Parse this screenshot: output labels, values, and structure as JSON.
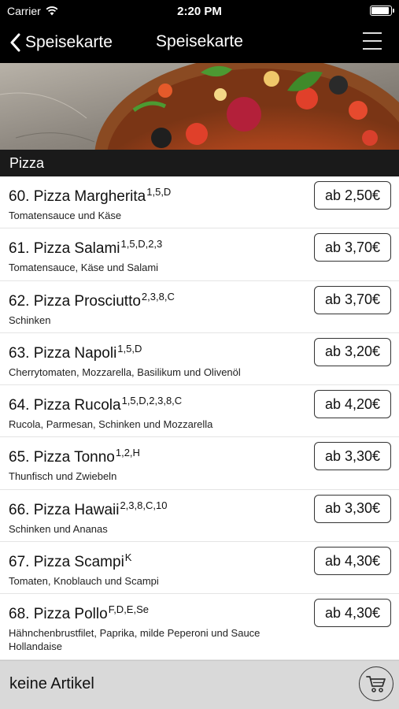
{
  "status_bar": {
    "carrier": "Carrier",
    "time": "2:20 PM"
  },
  "nav": {
    "back_label": "Speisekarte",
    "title": "Speisekarte"
  },
  "section": {
    "title": "Pizza"
  },
  "items": [
    {
      "name": "60. Pizza Margherita",
      "allergens": "1,5,D",
      "description": "Tomatensauce und Käse",
      "price": "ab 2,50€"
    },
    {
      "name": "61. Pizza Salami",
      "allergens": "1,5,D,2,3",
      "description": "Tomatensauce, Käse und Salami",
      "price": "ab 3,70€"
    },
    {
      "name": "62. Pizza Prosciutto",
      "allergens": "2,3,8,C",
      "description": "Schinken",
      "price": "ab 3,70€"
    },
    {
      "name": "63. Pizza Napoli",
      "allergens": "1,5,D",
      "description": "Cherrytomaten, Mozzarella, Basilikum und Olivenöl",
      "price": "ab 3,20€"
    },
    {
      "name": "64. Pizza Rucola",
      "allergens": "1,5,D,2,3,8,C",
      "description": "Rucola, Parmesan, Schinken und Mozzarella",
      "price": "ab 4,20€"
    },
    {
      "name": "65. Pizza Tonno",
      "allergens": "1,2,H",
      "description": "Thunfisch und Zwiebeln",
      "price": "ab 3,30€"
    },
    {
      "name": "66. Pizza Hawaii",
      "allergens": "2,3,8,C,10",
      "description": "Schinken und Ananas",
      "price": "ab 3,30€"
    },
    {
      "name": "67. Pizza Scampi",
      "allergens": "K",
      "description": "Tomaten, Knoblauch und Scampi",
      "price": "ab 4,30€"
    },
    {
      "name": "68. Pizza Pollo",
      "allergens": "F,D,E,Se",
      "description": "Hähnchenbrustfilet, Paprika, milde Peperoni und Sauce Hollandaise",
      "price": "ab 4,30€"
    }
  ],
  "footer": {
    "cart_status": "keine Artikel"
  },
  "icons": {
    "wifi": "wifi-icon",
    "battery": "battery-icon",
    "back": "chevron-left-icon",
    "menu": "hamburger-menu-icon",
    "cart": "shopping-cart-icon"
  }
}
